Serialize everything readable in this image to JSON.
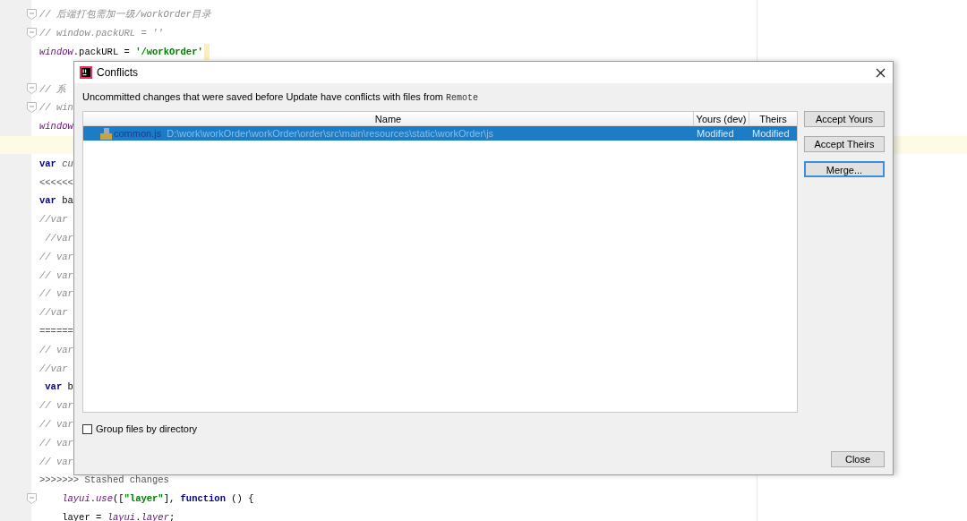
{
  "editor": {
    "lines": [
      {
        "fold": true,
        "current": false,
        "segments": [
          {
            "text": "// 后端打包需加一级/workOrder目录",
            "kind": "comment"
          }
        ]
      },
      {
        "fold": true,
        "current": false,
        "segments": [
          {
            "text": "// window.packURL = ''",
            "kind": "comment"
          }
        ]
      },
      {
        "fold": false,
        "current": false,
        "segments": [
          {
            "text": "window",
            "kind": "global"
          },
          {
            "text": ".packURL = ",
            "kind": "plain"
          },
          {
            "text": "'/workOrder'",
            "kind": "string"
          },
          {
            "kind": "caret"
          }
        ]
      },
      {
        "fold": false,
        "current": false
      },
      {
        "fold": true,
        "current": false,
        "segments": [
          {
            "text": "// 系",
            "kind": "comment"
          }
        ]
      },
      {
        "fold": true,
        "current": false,
        "segments": [
          {
            "text": "// win",
            "kind": "comment"
          }
        ]
      },
      {
        "fold": false,
        "current": false,
        "segments": [
          {
            "text": "window",
            "kind": "global"
          }
        ]
      },
      {
        "fold": false,
        "current": true
      },
      {
        "fold": false,
        "current": false,
        "segments": [
          {
            "text": "var",
            "kind": "keyword"
          },
          {
            "text": " cu",
            "kind": "italic"
          }
        ]
      },
      {
        "fold": false,
        "current": false,
        "segments": [
          {
            "text": "<<<<<<",
            "kind": "marker"
          }
        ]
      },
      {
        "fold": false,
        "current": false,
        "segments": [
          {
            "text": "var",
            "kind": "keyword"
          },
          {
            "text": " ba",
            "kind": "plain"
          }
        ]
      },
      {
        "fold": false,
        "current": false,
        "segments": [
          {
            "text": "//var",
            "kind": "comment"
          }
        ]
      },
      {
        "fold": false,
        "current": false,
        "segments": [
          {
            "text": " //var",
            "kind": "comment"
          }
        ]
      },
      {
        "fold": false,
        "current": false,
        "segments": [
          {
            "text": "// var",
            "kind": "comment"
          }
        ]
      },
      {
        "fold": false,
        "current": false,
        "segments": [
          {
            "text": "// var",
            "kind": "comment"
          }
        ]
      },
      {
        "fold": false,
        "current": false,
        "segments": [
          {
            "text": "// var",
            "kind": "comment"
          }
        ]
      },
      {
        "fold": false,
        "current": false,
        "segments": [
          {
            "text": "//var",
            "kind": "comment"
          }
        ]
      },
      {
        "fold": false,
        "current": false,
        "segments": [
          {
            "text": "======",
            "kind": "marker"
          }
        ]
      },
      {
        "fold": false,
        "current": false,
        "segments": [
          {
            "text": "// var",
            "kind": "comment"
          }
        ]
      },
      {
        "fold": false,
        "current": false,
        "segments": [
          {
            "text": "//var",
            "kind": "comment"
          }
        ]
      },
      {
        "fold": false,
        "current": false,
        "segments": [
          {
            "text": " var",
            "kind": "keyword"
          },
          {
            "text": " b",
            "kind": "plain"
          }
        ]
      },
      {
        "fold": false,
        "current": false,
        "segments": [
          {
            "text": "// var",
            "kind": "comment"
          }
        ]
      },
      {
        "fold": false,
        "current": false,
        "segments": [
          {
            "text": "// var",
            "kind": "comment"
          }
        ]
      },
      {
        "fold": false,
        "current": false,
        "segments": [
          {
            "text": "// var",
            "kind": "comment"
          }
        ]
      },
      {
        "fold": false,
        "current": false,
        "segments": [
          {
            "text": "// var",
            "kind": "comment"
          }
        ]
      },
      {
        "fold": false,
        "current": false,
        "segments": [
          {
            "text": ">>>>>>> Stashed changes",
            "kind": "marker"
          }
        ]
      },
      {
        "fold": true,
        "current": false,
        "segments": [
          {
            "text": "    layui",
            "kind": "global"
          },
          {
            "text": ".",
            "kind": "plain"
          },
          {
            "text": "use",
            "kind": "global"
          },
          {
            "text": "([",
            "kind": "plain"
          },
          {
            "text": "\"layer\"",
            "kind": "string"
          },
          {
            "text": "], ",
            "kind": "plain"
          },
          {
            "text": "function",
            "kind": "keyword"
          },
          {
            "text": " () {",
            "kind": "plain"
          }
        ]
      },
      {
        "fold": false,
        "current": false,
        "segments": [
          {
            "text": "    layer = ",
            "kind": "plain"
          },
          {
            "text": "layui",
            "kind": "global"
          },
          {
            "text": ".",
            "kind": "plain"
          },
          {
            "text": "layer",
            "kind": "global"
          },
          {
            "text": ";",
            "kind": "plain"
          }
        ]
      }
    ]
  },
  "dialog": {
    "title": "Conflicts",
    "message": {
      "text": "Uncommitted changes that were saved before Update have conflicts with files from",
      "source": "Remote"
    },
    "table": {
      "columns": [
        "Name",
        "Yours (dev)",
        "Theirs"
      ],
      "rows": [
        {
          "file": "common.js",
          "path": "D:\\work\\workOrder\\workOrder\\order\\src\\main\\resources\\static\\workOrder\\js",
          "yours": "Modified",
          "theirs": "Modified",
          "selected": true
        }
      ]
    },
    "buttons": [
      {
        "label": "Accept Yours",
        "focused": false
      },
      {
        "label": "Accept Theirs",
        "focused": false
      },
      {
        "label": "Merge...",
        "focused": true
      }
    ],
    "checkbox": {
      "label": "Group files by directory",
      "checked": false
    },
    "close_button": "Close"
  }
}
